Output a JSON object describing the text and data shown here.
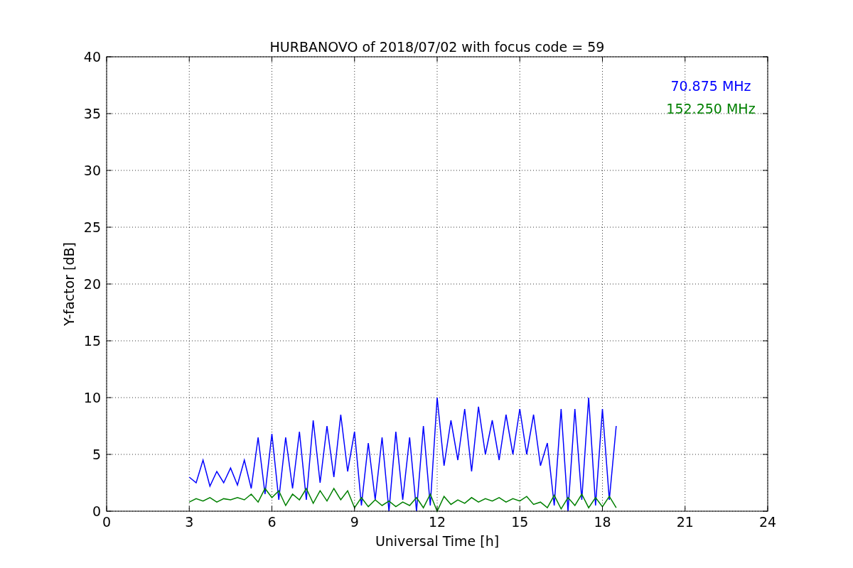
{
  "chart": {
    "chart_data": {
      "type": "line",
      "title": "HURBANOVO of 2018/07/02 with focus code = 59",
      "xlabel": "Universal Time [h]",
      "ylabel": "Y-factor [dB]",
      "x": [
        3,
        3.25,
        3.5,
        3.75,
        4,
        4.25,
        4.5,
        4.75,
        5,
        5.25,
        5.5,
        5.75,
        6,
        6.25,
        6.5,
        6.75,
        7,
        7.25,
        7.5,
        7.75,
        8,
        8.25,
        8.5,
        8.75,
        9,
        9.25,
        9.5,
        9.75,
        10,
        10.25,
        10.5,
        10.75,
        11,
        11.25,
        11.5,
        11.75,
        12,
        12.25,
        12.5,
        12.75,
        13,
        13.25,
        13.5,
        13.75,
        14,
        14.25,
        14.5,
        14.75,
        15,
        15.25,
        15.5,
        15.75,
        16,
        16.25,
        16.5,
        16.75,
        17,
        17.25,
        17.5,
        17.75,
        18,
        18.25,
        18.5
      ],
      "series": [
        {
          "name": "70.875 MHz",
          "color": "#0000ff",
          "values": [
            3,
            2.5,
            4.5,
            2.2,
            3.5,
            2.5,
            3.8,
            2.3,
            4.5,
            2,
            6.5,
            1.5,
            6.8,
            1,
            6.5,
            2,
            7,
            1,
            8,
            2.5,
            7.5,
            3,
            8.5,
            3.5,
            7,
            0.5,
            6,
            1,
            6.5,
            0,
            7,
            1,
            6.5,
            0,
            7.5,
            0.5,
            10,
            4,
            8,
            4.5,
            9,
            3.5,
            9.2,
            5,
            8,
            4.5,
            8.5,
            5,
            9,
            5,
            8.5,
            4,
            6,
            0.5,
            9,
            0,
            9,
            1,
            10,
            0.5,
            9,
            1,
            7.5
          ]
        },
        {
          "name": "152.250 MHz",
          "color": "#008000",
          "values": [
            0.8,
            1.1,
            0.9,
            1.2,
            0.8,
            1.1,
            1,
            1.2,
            1,
            1.5,
            0.8,
            2,
            1.2,
            1.8,
            0.5,
            1.5,
            1,
            2,
            0.7,
            1.8,
            0.9,
            2,
            1,
            1.8,
            0.3,
            1.2,
            0.4,
            1,
            0.5,
            0.9,
            0.4,
            0.8,
            0.5,
            1.2,
            0.3,
            1.5,
            0,
            1.3,
            0.6,
            1,
            0.7,
            1.2,
            0.8,
            1.1,
            0.9,
            1.2,
            0.8,
            1.1,
            0.9,
            1.3,
            0.6,
            0.8,
            0.3,
            1.4,
            0.2,
            1.2,
            0.5,
            1.5,
            0.3,
            1.2,
            0.4,
            1.3,
            0.3
          ]
        }
      ],
      "grid": true,
      "xlim": [
        0,
        24
      ],
      "ylim": [
        0,
        40
      ],
      "xticks": [
        0,
        3,
        6,
        9,
        12,
        15,
        18,
        21,
        24
      ],
      "yticks": [
        0,
        5,
        10,
        15,
        20,
        25,
        30,
        35,
        40
      ]
    }
  }
}
